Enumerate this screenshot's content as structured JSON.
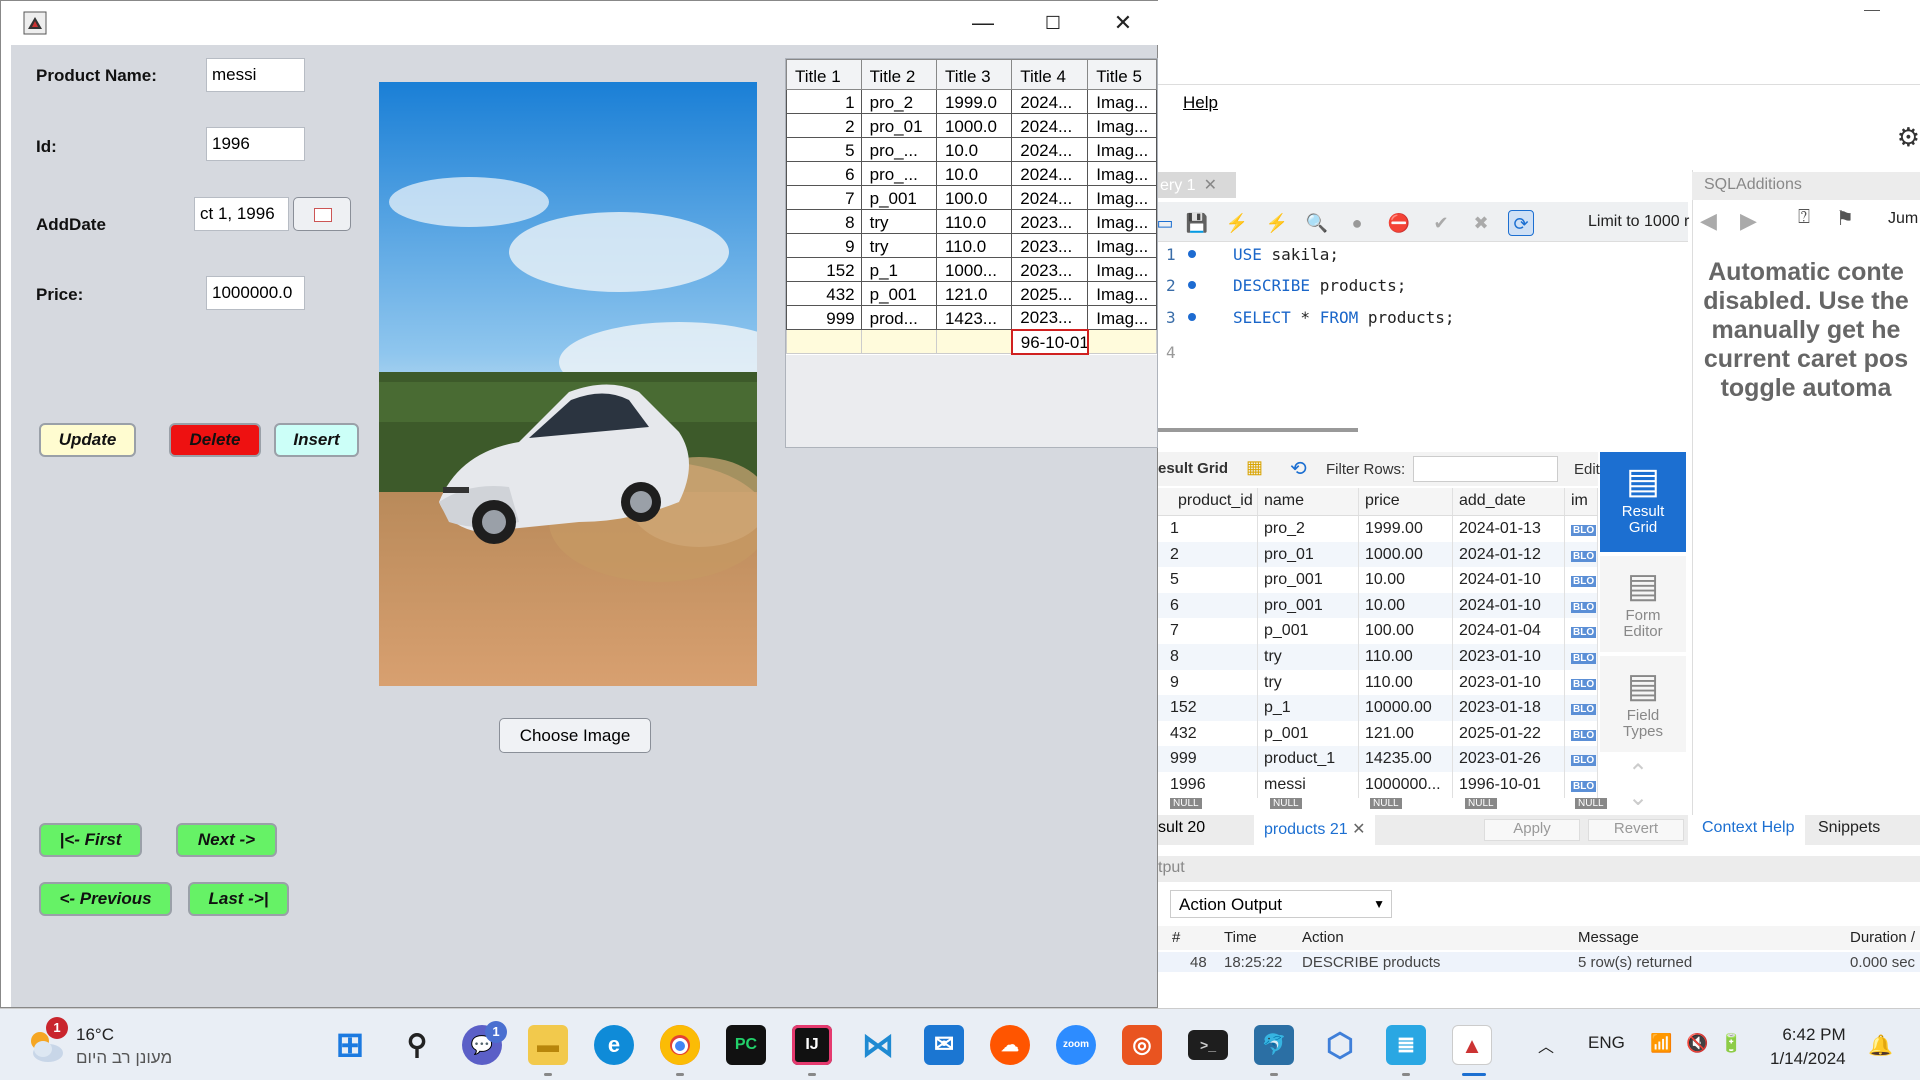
{
  "swing": {
    "labels": {
      "product_name": "Product Name:",
      "id": "Id:",
      "add_date": "AddDate",
      "price": "Price:"
    },
    "values": {
      "product_name": "messi",
      "id": "1996",
      "add_date": "ct 1, 1996",
      "price": "1000000.0"
    },
    "buttons": {
      "update": "Update",
      "delete": "Delete",
      "insert": "Insert",
      "choose_image": "Choose Image",
      "first": "|<- First",
      "next": "Next ->",
      "previous": "<- Previous",
      "last": "Last ->|"
    },
    "colors": {
      "update": "#fffcd0",
      "delete": "#ee1111",
      "insert": "#ccfff8",
      "nav": "#66f266",
      "panel": "#d6d9df"
    },
    "table": {
      "headers": [
        "Title 1",
        "Title 2",
        "Title 3",
        "Title 4",
        "Title 5"
      ],
      "rows": [
        [
          "1",
          "pro_2",
          "1999.0",
          "2024...",
          "Imag..."
        ],
        [
          "2",
          "pro_01",
          "1000.0",
          "2024...",
          "Imag..."
        ],
        [
          "5",
          "pro_...",
          "10.0",
          "2024...",
          "Imag..."
        ],
        [
          "6",
          "pro_...",
          "10.0",
          "2024...",
          "Imag..."
        ],
        [
          "7",
          "p_001",
          "100.0",
          "2024...",
          "Imag..."
        ],
        [
          "8",
          "try",
          "110.0",
          "2023...",
          "Imag..."
        ],
        [
          "9",
          "try",
          "110.0",
          "2023...",
          "Imag..."
        ],
        [
          "152",
          "p_1",
          "1000...",
          "2023...",
          "Imag..."
        ],
        [
          "432",
          "p_001",
          "121.0",
          "2025...",
          "Imag..."
        ],
        [
          "999",
          "prod...",
          "1423...",
          "2023...",
          "Imag..."
        ]
      ],
      "editing_value": "96-10-01"
    }
  },
  "workbench": {
    "menu_help": "Help",
    "query_tab": "ery 1",
    "limit": "Limit to 1000 r",
    "code": [
      {
        "n": "1",
        "kw": "USE",
        "rest": " sakila;"
      },
      {
        "n": "2",
        "kw": "DESCRIBE",
        "rest": " products;"
      },
      {
        "n": "3",
        "kw": "SELECT",
        "rest": " * ",
        "kw2": "FROM",
        "rest2": " products;"
      },
      {
        "n": "4"
      }
    ],
    "sidepanel_title": "SQLAdditions",
    "context_help": [
      "Automatic conte",
      "disabled. Use the",
      "manually get he",
      "current caret pos",
      "toggle automa"
    ],
    "result_grid_label": "esult Grid",
    "filter_rows": "Filter Rows:",
    "edit": "Edit",
    "grid_headers": [
      "product_id",
      "name",
      "price",
      "add_date",
      "im"
    ],
    "grid_rows": [
      [
        "1",
        "pro_2",
        "1999.00",
        "2024-01-13"
      ],
      [
        "2",
        "pro_01",
        "1000.00",
        "2024-01-12"
      ],
      [
        "5",
        "pro_001",
        "10.00",
        "2024-01-10"
      ],
      [
        "6",
        "pro_001",
        "10.00",
        "2024-01-10"
      ],
      [
        "7",
        "p_001",
        "100.00",
        "2024-01-04"
      ],
      [
        "8",
        "try",
        "110.00",
        "2023-01-10"
      ],
      [
        "9",
        "try",
        "110.00",
        "2023-01-10"
      ],
      [
        "152",
        "p_1",
        "10000.00",
        "2023-01-18"
      ],
      [
        "432",
        "p_001",
        "121.00",
        "2025-01-22"
      ],
      [
        "999",
        "product_1",
        "14235.00",
        "2023-01-26"
      ],
      [
        "1996",
        "messi",
        "1000000...",
        "1996-10-01"
      ]
    ],
    "blob": "BLO",
    "null": "NULL",
    "side_buttons": {
      "result_grid": "Result Grid",
      "form_editor": "Form Editor",
      "field_types": "Field Types"
    },
    "result_tabs": {
      "tab1": "sult 20",
      "tab2": "products 21"
    },
    "apply": "Apply",
    "revert": "Revert",
    "context_tabs": {
      "help": "Context Help",
      "snippets": "Snippets"
    },
    "output_label": "tput",
    "action_output": "Action Output",
    "output_headers": {
      "num": "#",
      "time": "Time",
      "action": "Action",
      "message": "Message",
      "duration": "Duration /"
    },
    "output_row": {
      "num": "48",
      "time": "18:25:22",
      "action": "DESCRIBE products",
      "message": "5 row(s) returned",
      "duration": "0.000 sec"
    }
  },
  "taskbar": {
    "temp": "16°C",
    "weather_desc": "מעונן רב היום",
    "weather_badge": "1",
    "teams_badge": "1",
    "lang": "ENG",
    "time": "6:42 PM",
    "date": "1/14/2024",
    "zoom": "zoom"
  }
}
